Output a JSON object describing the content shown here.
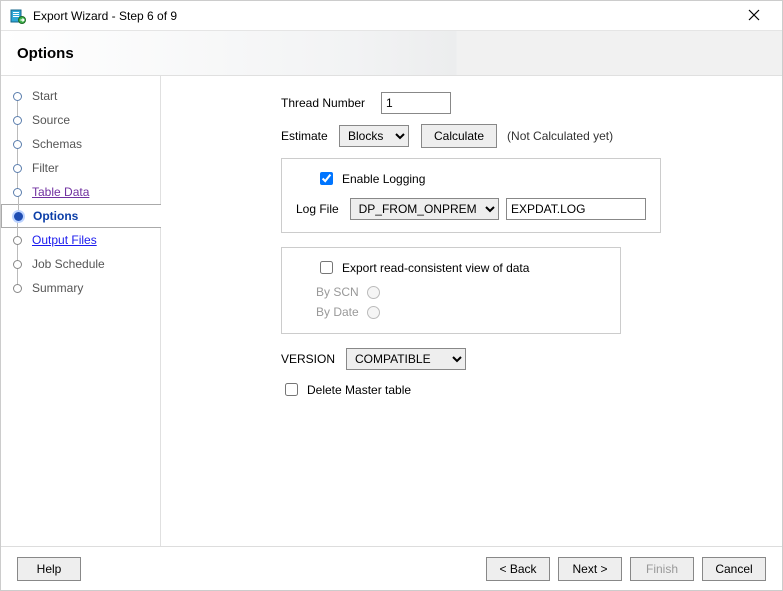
{
  "window": {
    "title": "Export Wizard - Step 6 of 9"
  },
  "header": {
    "title": "Options"
  },
  "sidebar": {
    "items": [
      {
        "label": "Start"
      },
      {
        "label": "Source"
      },
      {
        "label": "Schemas"
      },
      {
        "label": "Filter"
      },
      {
        "label": "Table Data"
      },
      {
        "label": "Options"
      },
      {
        "label": "Output Files"
      },
      {
        "label": "Job Schedule"
      },
      {
        "label": "Summary"
      }
    ]
  },
  "form": {
    "thread_label": "Thread Number",
    "thread_value": "1",
    "estimate_label": "Estimate",
    "estimate_value": "Blocks",
    "calculate_btn": "Calculate",
    "calc_hint": "(Not Calculated yet)",
    "enable_logging_label": "Enable Logging",
    "log_file_label": "Log File",
    "log_file_dir": "DP_FROM_ONPREM",
    "log_file_name": "EXPDAT.LOG",
    "export_consistent_label": "Export read-consistent view of data",
    "by_scn_label": "By SCN",
    "by_date_label": "By Date",
    "version_label": "VERSION",
    "version_value": "COMPATIBLE",
    "delete_master_label": "Delete Master table"
  },
  "footer": {
    "help": "Help",
    "back": "< Back",
    "next": "Next >",
    "finish": "Finish",
    "cancel": "Cancel"
  }
}
